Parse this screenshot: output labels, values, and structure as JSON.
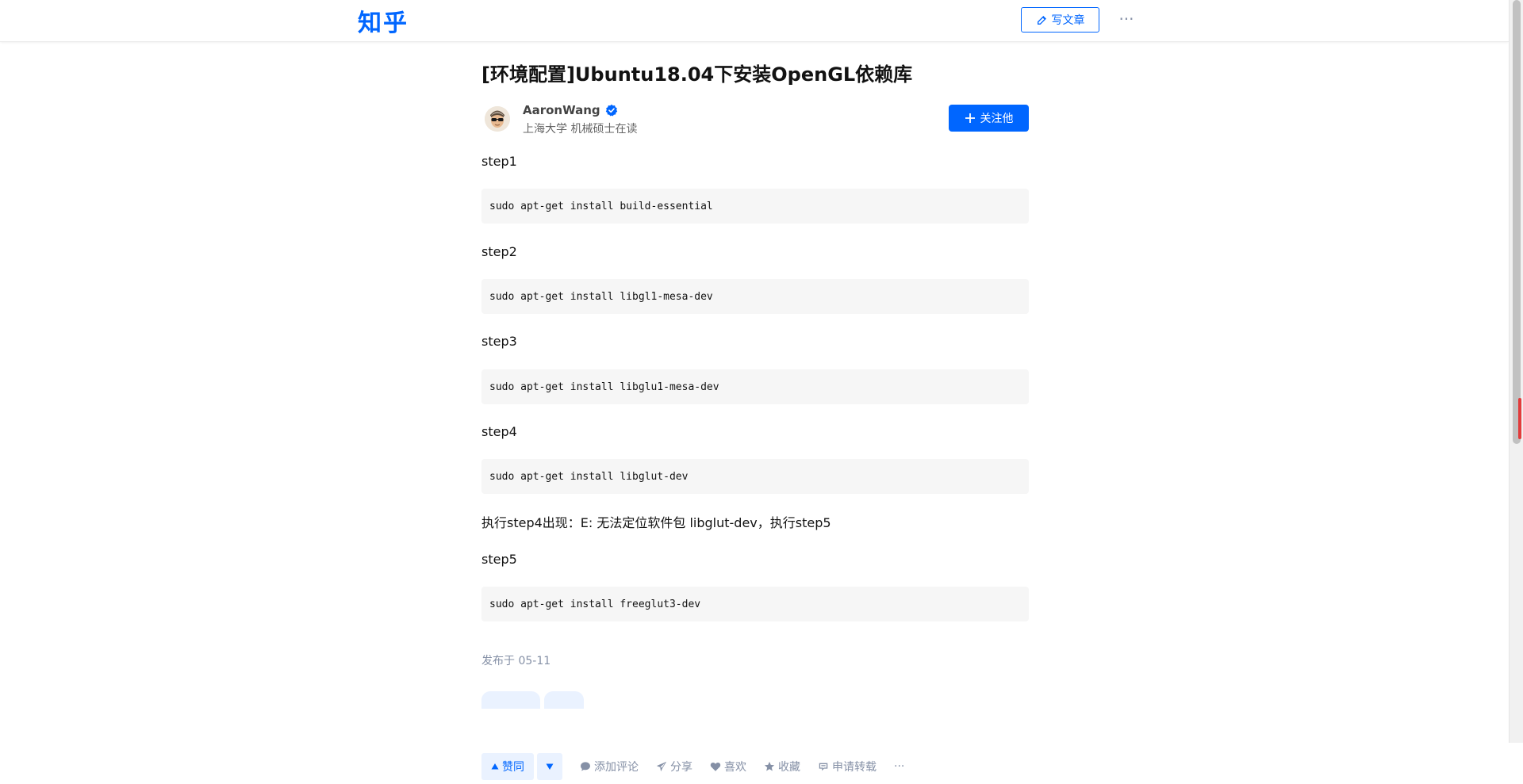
{
  "header": {
    "logo": "知乎",
    "write_label": "写文章",
    "more_label": "···"
  },
  "article": {
    "title": "[环境配置]Ubuntu18.04下安装OpenGL依赖库",
    "author": {
      "name": "AaronWang",
      "bio": "上海大学 机械硕士在读",
      "follow_label": "关注他"
    },
    "steps": [
      {
        "label": "step1",
        "code": "sudo apt-get install build-essential"
      },
      {
        "label": "step2",
        "code": "sudo apt-get install libgl1-mesa-dev"
      },
      {
        "label": "step3",
        "code": "sudo apt-get install libglu1-mesa-dev"
      },
      {
        "label": "step4",
        "code": "sudo apt-get install libglut-dev"
      },
      {
        "label": "step5",
        "code": "sudo apt-get install freeglut3-dev"
      }
    ],
    "note": "执行step4出现：E: 无法定位软件包 libglut-dev，执行step5",
    "published": "发布于 05-11"
  },
  "actions": {
    "vote_up_label": "赞同",
    "comment_label": "添加评论",
    "share_label": "分享",
    "like_label": "喜欢",
    "favorite_label": "收藏",
    "repost_label": "申请转载",
    "more_label": "···"
  },
  "colors": {
    "accent": "#0066ff",
    "muted": "#8590a6",
    "code_bg": "#f6f6f6"
  }
}
